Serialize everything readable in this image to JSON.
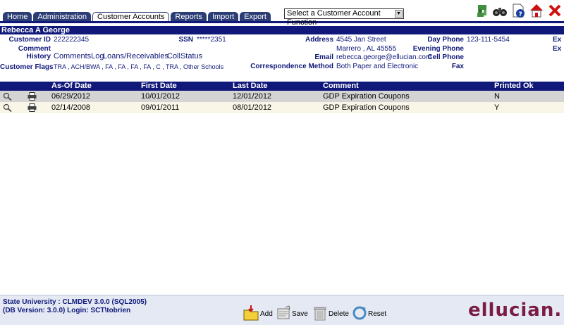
{
  "nav": {
    "tabs": [
      "Home",
      "Administration",
      "Customer Accounts",
      "Reports",
      "Import",
      "Export"
    ],
    "function_select": "Select a Customer Account Function"
  },
  "toolbar_icons": [
    "user-icon",
    "binoculars-icon",
    "help-document-icon",
    "home-icon",
    "close-icon"
  ],
  "customer": {
    "name": "Rebecca A George",
    "id_label": "Customer ID",
    "id": "222222345",
    "ssn_label": "SSN",
    "ssn": "*****2351",
    "comment_label": "Comment",
    "history_label": "History",
    "links": [
      "CommentsLog",
      "Loans/Receivables",
      "CollStatus"
    ],
    "flags_label": "Customer Flags",
    "flags": "TRA , ACH/BWA , FA , FA , FA , FA , C , TRA , Other Schools",
    "address_label": "Address",
    "address_line1": "4545 Jan Street",
    "address_line2": "Marrero , AL 45555",
    "email_label": "Email",
    "email": "rebecca.george@ellucian.com",
    "correspondence_label": "Correspondence Method",
    "correspondence": "Both Paper and Electronic",
    "day_phone_label": "Day Phone",
    "day_phone": "123-111-5454",
    "evening_phone_label": "Evening Phone",
    "cell_phone_label": "Cell Phone",
    "fax_label": "Fax",
    "ext1": "Ex",
    "ext2": "Ex"
  },
  "grid": {
    "columns": [
      "As-Of Date",
      "First Date",
      "Last Date",
      "Comment",
      "Printed Ok"
    ],
    "rows": [
      {
        "as_of": "06/29/2012",
        "first": "10/01/2012",
        "last": "12/01/2012",
        "comment": "GDP Expiration Coupons",
        "printed": "N"
      },
      {
        "as_of": "02/14/2008",
        "first": "09/01/2011",
        "last": "08/01/2012",
        "comment": "GDP Expiration Coupons",
        "printed": "Y"
      }
    ]
  },
  "footer": {
    "status_line1": "State University : CLMDEV 3.0.0 (SQL2005)",
    "status_line2": "(DB Version: 3.0.0) Login: SCT\\tobrien",
    "add_label": "Add",
    "save_label": "Save",
    "delete_label": "Delete",
    "reset_label": "Reset",
    "brand": "ellucian."
  },
  "colors": {
    "navy": "#10197a",
    "row_selected": "#d4d4d4",
    "row_alt": "#f9f6e8",
    "brand": "#7b1c45"
  }
}
